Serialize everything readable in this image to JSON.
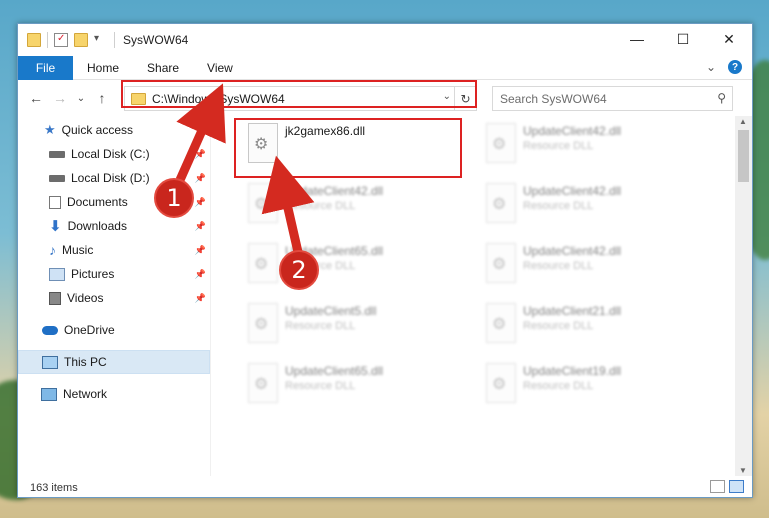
{
  "window": {
    "title": "SysWOW64",
    "controls": {
      "minimize": "—",
      "maximize": "☐",
      "close": "✕"
    }
  },
  "ribbon": {
    "tabs": [
      "File",
      "Home",
      "Share",
      "View"
    ],
    "help": "?",
    "expand": "⌄"
  },
  "address": {
    "path": "C:\\Windows\\SysWOW64",
    "dropdown": "⌄",
    "refresh": "↻"
  },
  "search": {
    "placeholder": "Search SysWOW64",
    "icon": "magnifier-icon"
  },
  "nav": {
    "back": "←",
    "forward": "→",
    "recent": "⌄",
    "up": "↑"
  },
  "sidebar": {
    "items": [
      {
        "label": "Quick access",
        "icon": "star-icon"
      },
      {
        "label": "Local Disk (C:)",
        "icon": "drive-icon",
        "pinned": true
      },
      {
        "label": "Local Disk (D:)",
        "icon": "drive-icon",
        "pinned": true
      },
      {
        "label": "Documents",
        "icon": "documents-icon",
        "pinned": true
      },
      {
        "label": "Downloads",
        "icon": "download-icon",
        "pinned": true
      },
      {
        "label": "Music",
        "icon": "music-icon",
        "pinned": true
      },
      {
        "label": "Pictures",
        "icon": "pictures-icon",
        "pinned": true
      },
      {
        "label": "Videos",
        "icon": "videos-icon",
        "pinned": true
      },
      {
        "label": "OneDrive",
        "icon": "cloud-icon"
      },
      {
        "label": "This PC",
        "icon": "computer-icon",
        "selected": true
      },
      {
        "label": "Network",
        "icon": "network-icon"
      }
    ]
  },
  "files": [
    {
      "name": "jk2gamex86.dll",
      "type": "",
      "clear": true
    },
    {
      "name": "UpdateClient42.dll",
      "type": "Resource DLL"
    },
    {
      "name": "UpdateClient42.dll",
      "type": "Resource DLL"
    },
    {
      "name": "UpdateClient42.dll",
      "type": "Resource DLL"
    },
    {
      "name": "UpdateClient65.dll",
      "type": "Resource DLL"
    },
    {
      "name": "UpdateClient42.dll",
      "type": "Resource DLL"
    },
    {
      "name": "UpdateClient5.dll",
      "type": "Resource DLL"
    },
    {
      "name": "UpdateClient21.dll",
      "type": "Resource DLL"
    },
    {
      "name": "UpdateClient65.dll",
      "type": "Resource DLL"
    },
    {
      "name": "UpdateClient19.dll",
      "type": "Resource DLL"
    }
  ],
  "status": {
    "count": "163 items"
  },
  "callouts": [
    "1",
    "2"
  ],
  "colors": {
    "accent": "#1979ca",
    "callout": "#c9261d",
    "highlight": "#dd2222"
  }
}
